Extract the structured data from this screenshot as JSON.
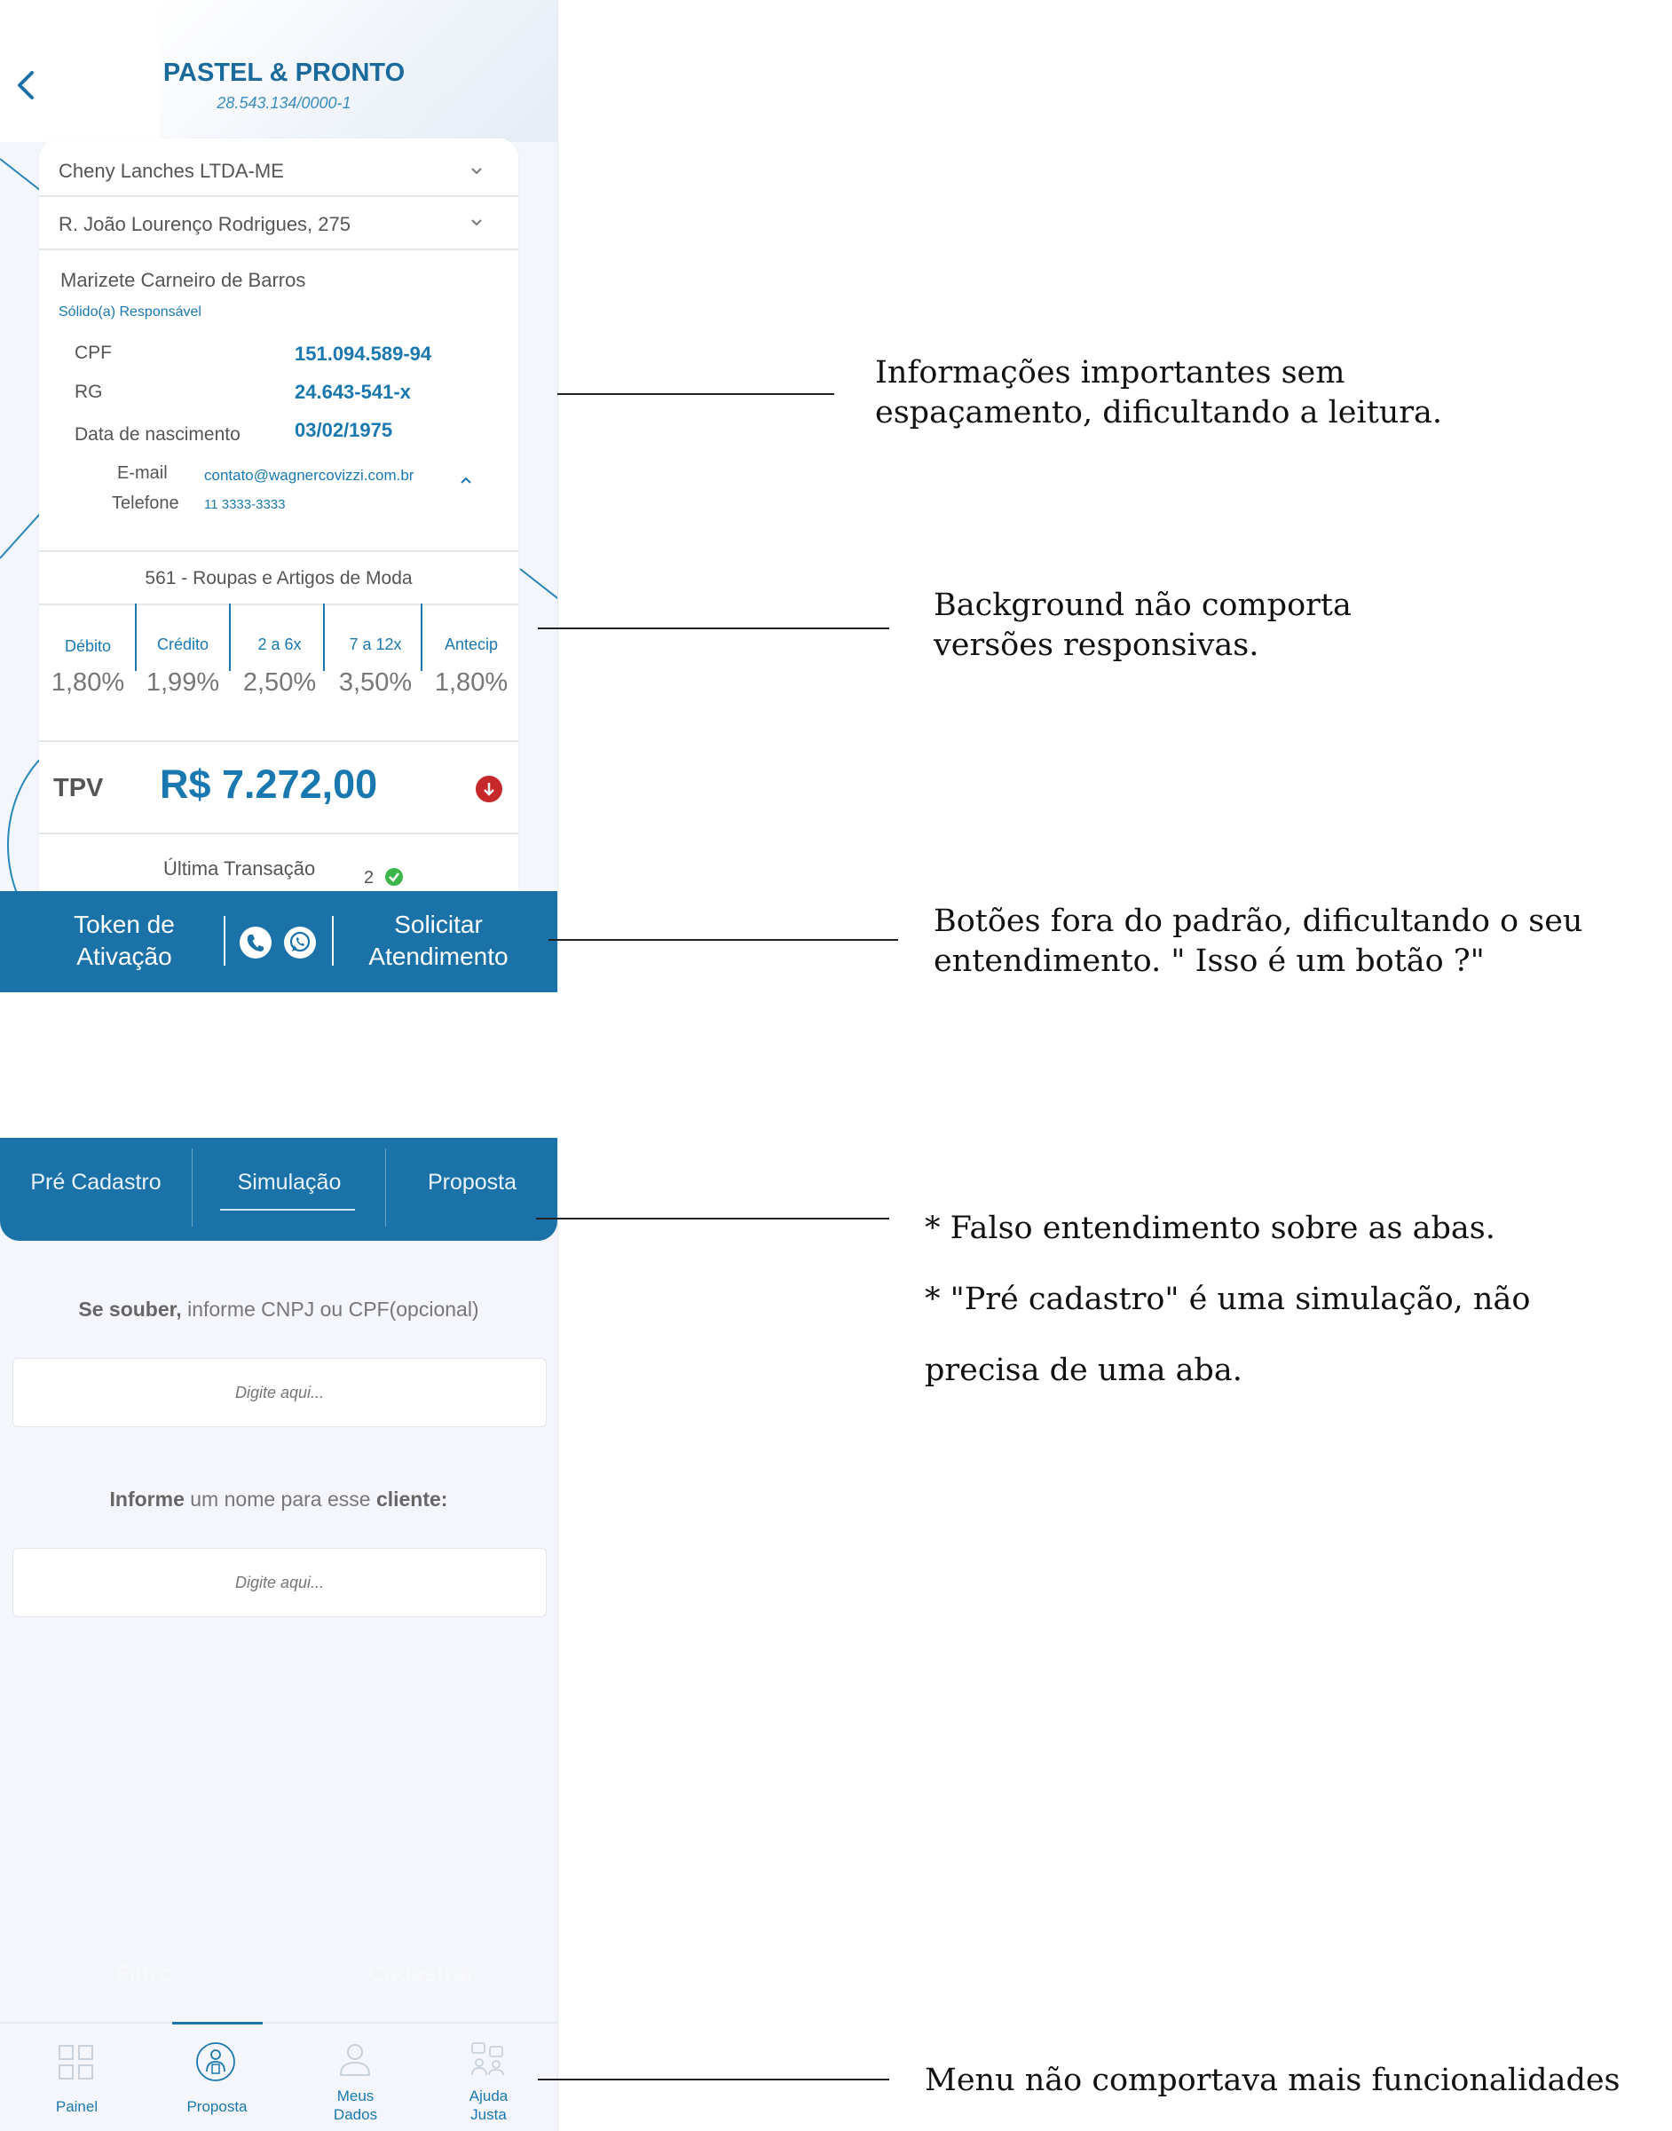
{
  "screen1": {
    "title": "PASTEL & PRONTO",
    "cnpj": "28.543.134/0000-1",
    "company_select": "Cheny Lanches LTDA-ME",
    "address_select": "R. João Lourenço Rodrigues, 275",
    "person": {
      "name": "Marizete Carneiro de Barros",
      "role": "Sólido(a) Responsável",
      "cpf_label": "CPF",
      "cpf": "151.094.589-94",
      "rg_label": "RG",
      "rg": "24.643-541-x",
      "birth_label": "Data de nascimento",
      "birth": "03/02/1975",
      "email_label": "E-mail",
      "email": "contato@wagnercovizzi.com.br",
      "phone_label": "Telefone",
      "phone": "11 3333-3333"
    },
    "category": "561 - Roupas e Artigos de Moda",
    "rates": [
      {
        "label": "Débito",
        "value": "1,80%"
      },
      {
        "label": "Crédito",
        "value": "1,99%"
      },
      {
        "label": "2 a 6x",
        "value": "2,50%"
      },
      {
        "label": "7 a 12x",
        "value": "3,50%"
      },
      {
        "label": "Antecip",
        "value": "1,80%"
      }
    ],
    "tpv_label": "TPV",
    "tpv_value": "R$ 7.272,00",
    "last_transaction_label": "Última Transação",
    "last_transaction_count": "2",
    "actions": {
      "token_line1": "Token de",
      "token_line2": "Ativação",
      "support_line1": "Solicitar",
      "support_line2": "Atendimento"
    },
    "colors": {
      "primary": "#1a72a8",
      "accent_text": "#1a78b0",
      "alert": "#c7282a",
      "ok": "#3cb54a"
    }
  },
  "screen2": {
    "tabs": [
      {
        "label": "Pré Cadastro"
      },
      {
        "label": "Simulação"
      },
      {
        "label": "Proposta"
      }
    ],
    "field1": {
      "label_bold": "Se souber,",
      "label_rest": " informe CNPJ ou CPF(opcional)",
      "placeholder": "Digite aqui..."
    },
    "field2": {
      "label_bold1": "Informe",
      "label_mid": " um nome para esse ",
      "label_bold2": "cliente:",
      "placeholder": "Digite aqui..."
    },
    "ghost_buttons": {
      "left": "Filtro",
      "right": "Cadastrar"
    },
    "nav": [
      {
        "label": "Painel",
        "icon": "grid-icon"
      },
      {
        "label": "Proposta",
        "icon": "person-document-icon"
      },
      {
        "label": "Meus Dados",
        "label_line1": "Meus",
        "label_line2": "Dados",
        "icon": "user-icon"
      },
      {
        "label": "Ajuda Justa",
        "label_line1": "Ajuda",
        "label_line2": "Justa",
        "icon": "help-people-icon"
      }
    ]
  },
  "annotations": [
    {
      "line1": "Informações importantes sem",
      "line2": "espaçamento, dificultando a leitura."
    },
    {
      "line1": "Background não comporta",
      "line2": "versões responsivas."
    },
    {
      "line1": "Botões fora do padrão, dificultando o seu",
      "line2": "entendimento. \" Isso é um botão ?\""
    },
    {
      "line1": "* Falso entendimento sobre as abas.",
      "line2": "* \"Pré cadastro\" é uma simulação, não",
      "line3": "precisa de uma aba."
    },
    {
      "line1": "Menu não comportava mais funcionalidades"
    }
  ]
}
